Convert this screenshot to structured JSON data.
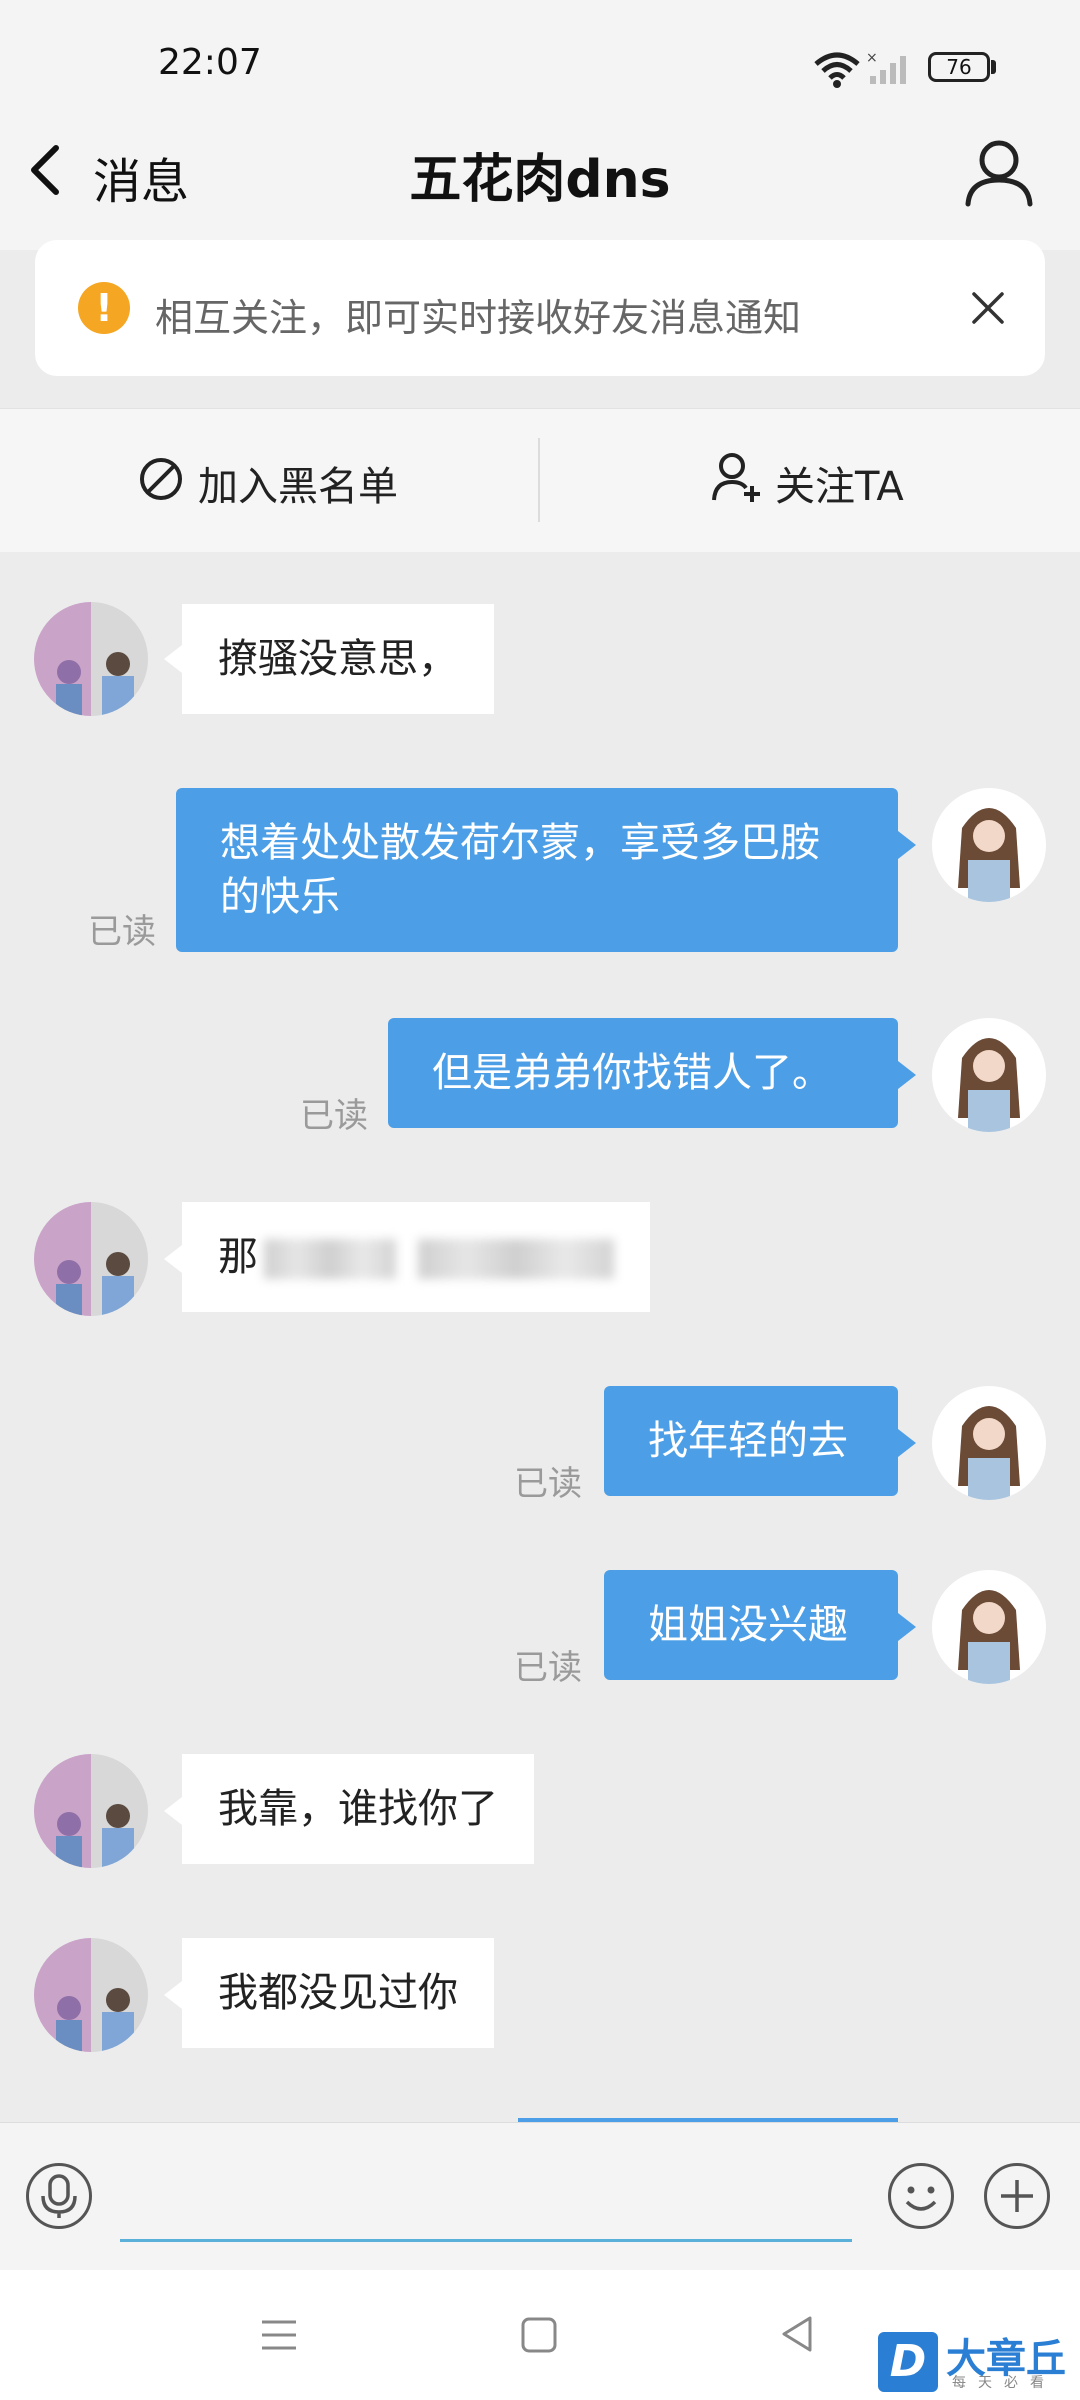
{
  "status_bar": {
    "time": "22:07",
    "battery": "76",
    "icons": [
      "wifi-icon",
      "signal-no-sim-icon",
      "signal-bars-icon",
      "battery-icon"
    ]
  },
  "header": {
    "back_label": "消息",
    "title": "五花肉dns",
    "profile_icon": "person-icon"
  },
  "banner": {
    "icon": "warning-icon",
    "warning_glyph": "!",
    "text": "相互关注，即可实时接收好友消息通知",
    "close_icon": "close-icon"
  },
  "actions": {
    "blacklist_label": "加入黑名单",
    "follow_label": "关注TA"
  },
  "messages": [
    {
      "from": "other",
      "text": "撩骚没意思，"
    },
    {
      "from": "me",
      "text": "想着处处散发荷尔蒙，享受多巴胺的快乐",
      "status": "已读"
    },
    {
      "from": "me",
      "text": "但是弟弟你找错人了。",
      "status": "已读"
    },
    {
      "from": "other",
      "text": "那",
      "redacted": true
    },
    {
      "from": "me",
      "text": "找年轻的去",
      "status": "已读"
    },
    {
      "from": "me",
      "text": "姐姐没兴趣",
      "status": "已读"
    },
    {
      "from": "other",
      "text": "我靠，谁找你了"
    },
    {
      "from": "other",
      "text": "我都没见过你"
    }
  ],
  "input_bar": {
    "placeholder": "",
    "icons": [
      "microphone-icon",
      "emoji-icon",
      "plus-icon"
    ]
  },
  "nav_bar": {
    "icons": [
      "menu-icon",
      "home-square-icon",
      "back-triangle-icon"
    ]
  },
  "watermark": {
    "badge": "D",
    "text": "大章丘",
    "subtext": "每天必看"
  },
  "colors": {
    "sent_bubble": "#4c9fe6",
    "received_bubble": "#ffffff",
    "chat_background": "#ececec",
    "warning": "#f5a623",
    "input_underline": "#5ab0d8"
  }
}
